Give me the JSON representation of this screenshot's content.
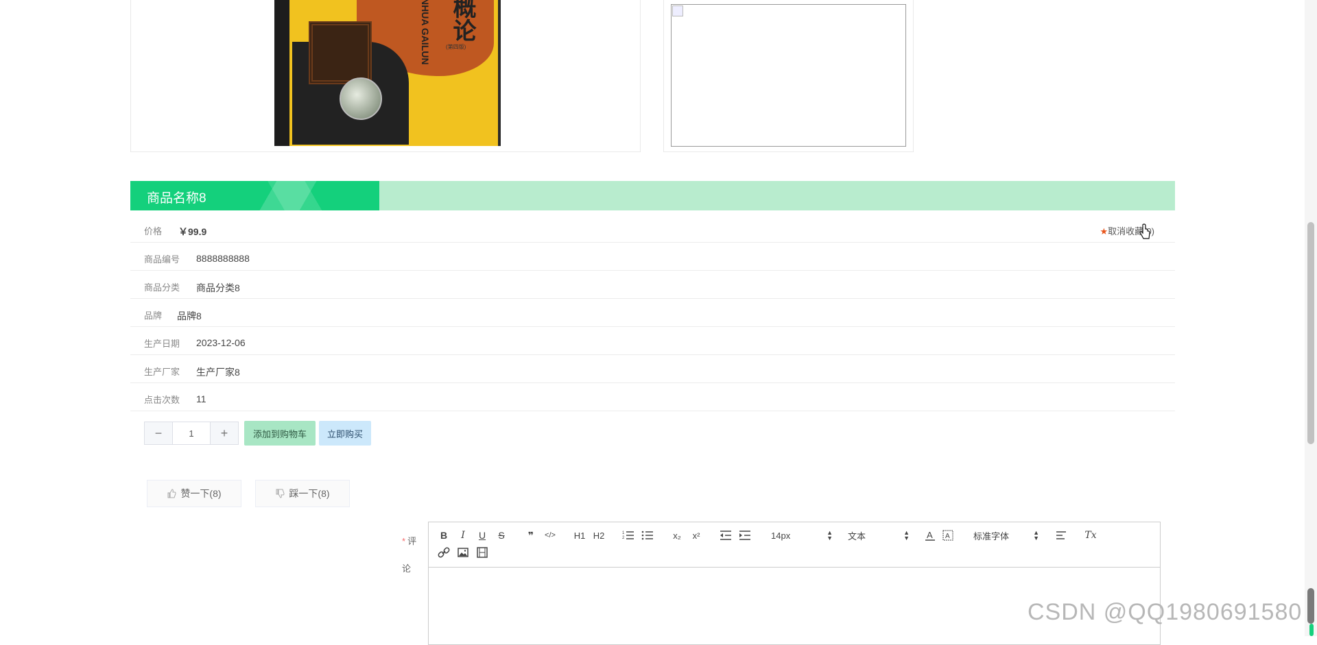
{
  "product": {
    "name": "商品名称8",
    "fields": [
      {
        "label": "价格",
        "value": "￥99.9"
      },
      {
        "label": "商品编号",
        "value": "8888888888"
      },
      {
        "label": "商品分类",
        "value": "商品分类8"
      },
      {
        "label": "品牌",
        "value": "品牌8"
      },
      {
        "label": "生产日期",
        "value": "2023-12-06"
      },
      {
        "label": "生产厂家",
        "value": "生产厂家8"
      },
      {
        "label": "点击次数",
        "value": "11"
      }
    ],
    "favorite_label": "取消收藏(0)",
    "book_cover": {
      "title_cn": "概论",
      "title_en": "NHUA GAILUN",
      "edition": "(第四版)"
    }
  },
  "purchase": {
    "quantity": "1",
    "minus_label": "−",
    "plus_label": "+",
    "add_cart_label": "添加到购物车",
    "buy_now_label": "立即购买"
  },
  "vote": {
    "like_label": "赞一下(8)",
    "dislike_label": "踩一下(8)"
  },
  "comment": {
    "required_mark": "*",
    "label": "评论",
    "toolbar": {
      "bold": "B",
      "italic": "I",
      "underline": "U",
      "strike": "S",
      "quote": "❞",
      "code": "</>",
      "h1": "H1",
      "h2": "H2",
      "subscript": "x₂",
      "superscript": "x²",
      "font_size": "14px",
      "text_type": "文本",
      "font_family": "标准字体",
      "clear_format": "Tx"
    }
  },
  "watermark": "CSDN @QQ1980691580",
  "colors": {
    "title_accent": "#14d07c",
    "title_bar_bg": "#b8ecce",
    "cart_button": "#a8e6c4",
    "buy_button": "#cce8fb",
    "favorite_star": "#e8541a"
  }
}
